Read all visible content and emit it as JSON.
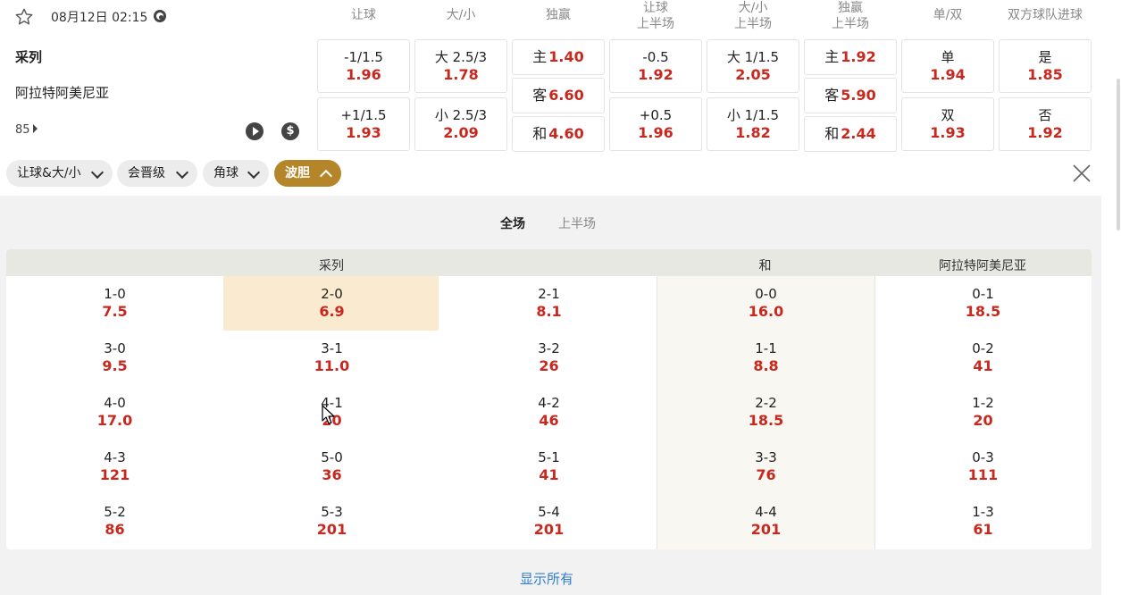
{
  "match": {
    "datetime": "08月12日 02:15",
    "home_team": "采列",
    "away_team": "阿拉特阿美尼亚",
    "more_markets": "85"
  },
  "columns": [
    {
      "line1": "让球",
      "line2": ""
    },
    {
      "line1": "大/小",
      "line2": ""
    },
    {
      "line1": "独赢",
      "line2": ""
    },
    {
      "line1": "让球",
      "line2": "上半场"
    },
    {
      "line1": "大/小",
      "line2": "上半场"
    },
    {
      "line1": "独赢",
      "line2": "上半场"
    },
    {
      "line1": "单/双",
      "line2": ""
    },
    {
      "line1": "双方球队进球",
      "line2": ""
    }
  ],
  "odds": {
    "handicap": [
      {
        "label": "-1/1.5",
        "value": "1.96"
      },
      {
        "label": "+1/1.5",
        "value": "1.93"
      }
    ],
    "total": [
      {
        "label": "大 2.5/3",
        "value": "1.78"
      },
      {
        "label": "小 2.5/3",
        "value": "2.09"
      }
    ],
    "moneyline": [
      {
        "label": "主",
        "value": "1.40"
      },
      {
        "label": "客",
        "value": "6.60"
      },
      {
        "label": "和",
        "value": "4.60"
      }
    ],
    "handicap_1h": [
      {
        "label": "-0.5",
        "value": "1.92"
      },
      {
        "label": "+0.5",
        "value": "1.96"
      }
    ],
    "total_1h": [
      {
        "label": "大 1/1.5",
        "value": "2.05"
      },
      {
        "label": "小 1/1.5",
        "value": "1.82"
      }
    ],
    "moneyline_1h": [
      {
        "label": "主",
        "value": "1.92"
      },
      {
        "label": "客",
        "value": "5.90"
      },
      {
        "label": "和",
        "value": "2.44"
      }
    ],
    "odd_even": [
      {
        "label": "单",
        "value": "1.94"
      },
      {
        "label": "双",
        "value": "1.93"
      }
    ],
    "btts": [
      {
        "label": "是",
        "value": "1.85"
      },
      {
        "label": "否",
        "value": "1.92"
      }
    ]
  },
  "filters": [
    {
      "label": "让球&大/小",
      "active": false
    },
    {
      "label": "会晋级",
      "active": false
    },
    {
      "label": "角球",
      "active": false
    },
    {
      "label": "波胆",
      "active": true
    }
  ],
  "period_tabs": [
    {
      "label": "全场",
      "active": true
    },
    {
      "label": "上半场",
      "active": false
    }
  ],
  "correct_score": {
    "headers": {
      "home": "采列",
      "draw": "和",
      "away": "阿拉特阿美尼亚"
    },
    "columns": [
      [
        {
          "score": "1-0",
          "odds": "7.5"
        },
        {
          "score": "3-0",
          "odds": "9.5"
        },
        {
          "score": "4-0",
          "odds": "17.0"
        },
        {
          "score": "4-3",
          "odds": "121"
        },
        {
          "score": "5-2",
          "odds": "86"
        }
      ],
      [
        {
          "score": "2-0",
          "odds": "6.9"
        },
        {
          "score": "3-1",
          "odds": "11.0"
        },
        {
          "score": "4-1",
          "odds": "20"
        },
        {
          "score": "5-0",
          "odds": "36"
        },
        {
          "score": "5-3",
          "odds": "201"
        }
      ],
      [
        {
          "score": "2-1",
          "odds": "8.1"
        },
        {
          "score": "3-2",
          "odds": "26"
        },
        {
          "score": "4-2",
          "odds": "46"
        },
        {
          "score": "5-1",
          "odds": "41"
        },
        {
          "score": "5-4",
          "odds": "201"
        }
      ],
      [
        {
          "score": "0-0",
          "odds": "16.0"
        },
        {
          "score": "1-1",
          "odds": "8.8"
        },
        {
          "score": "2-2",
          "odds": "18.5"
        },
        {
          "score": "3-3",
          "odds": "76"
        },
        {
          "score": "4-4",
          "odds": "201"
        }
      ],
      [
        {
          "score": "0-1",
          "odds": "18.5"
        },
        {
          "score": "0-2",
          "odds": "41"
        },
        {
          "score": "1-2",
          "odds": "20"
        },
        {
          "score": "0-3",
          "odds": "111"
        },
        {
          "score": "1-3",
          "odds": "61"
        }
      ]
    ]
  },
  "show_all": "显示所有"
}
